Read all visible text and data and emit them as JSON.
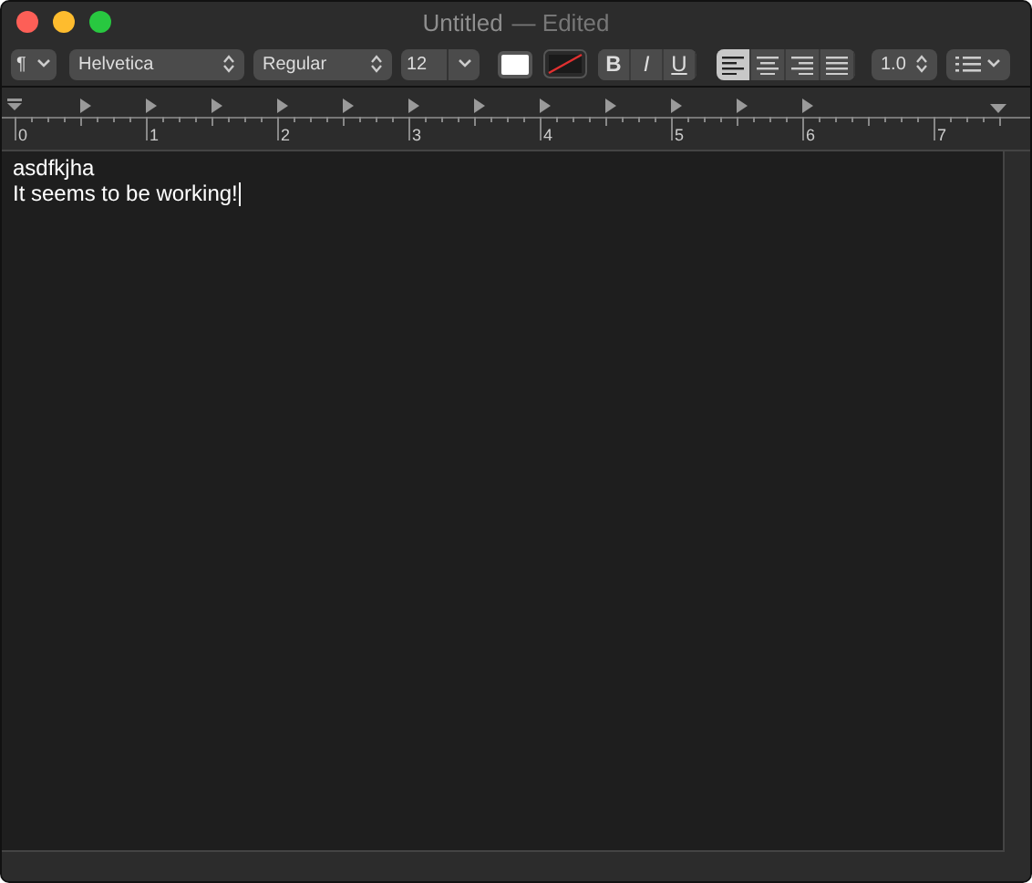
{
  "window": {
    "title": "Untitled",
    "status": "— Edited"
  },
  "toolbar": {
    "paragraph_style": "¶",
    "font": "Helvetica",
    "typeface": "Regular",
    "size": "12",
    "styles": [
      {
        "label": "B",
        "kind": "bold",
        "selected": false
      },
      {
        "label": "I",
        "kind": "italic",
        "selected": false
      },
      {
        "label": "U",
        "kind": "underline",
        "selected": false
      }
    ],
    "alignment": [
      {
        "kind": "left",
        "selected": true
      },
      {
        "kind": "center",
        "selected": false
      },
      {
        "kind": "right",
        "selected": false
      },
      {
        "kind": "justify",
        "selected": false
      }
    ],
    "spacing": "1.0"
  },
  "ruler": {
    "numbers": [
      "0",
      "1",
      "2",
      "3",
      "4",
      "5",
      "6",
      "7"
    ]
  },
  "document": {
    "lines": [
      "asdfkjha",
      "It seems to be working!"
    ]
  }
}
